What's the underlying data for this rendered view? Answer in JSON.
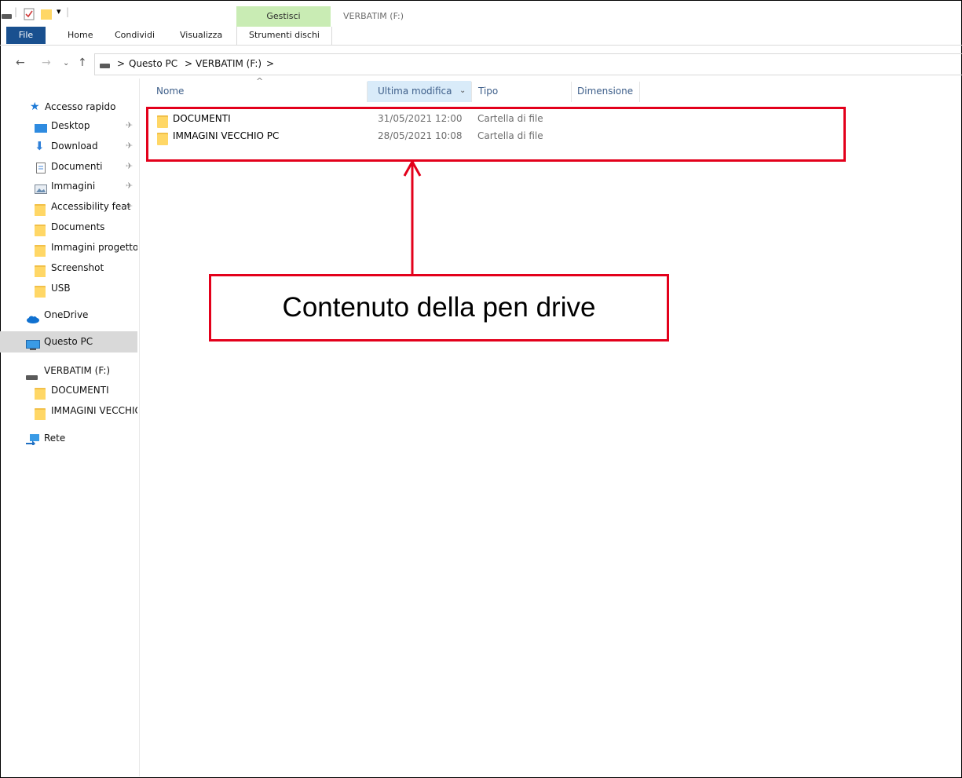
{
  "window": {
    "title": "VERBATIM (F:)",
    "context_tab_group": "Gestisci",
    "accent": "#19508f",
    "context_accent": "#c9ecb4"
  },
  "ribbon": {
    "tabs": [
      {
        "label": "File"
      },
      {
        "label": "Home"
      },
      {
        "label": "Condividi"
      },
      {
        "label": "Visualizza"
      },
      {
        "label": "Strumenti dischi"
      }
    ]
  },
  "address": {
    "crumbs": [
      "Questo PC",
      "VERBATIM (F:)"
    ],
    "separator": ">"
  },
  "sidebar": {
    "quick_access": "Accesso rapido",
    "items": [
      {
        "label": "Desktop",
        "icon": "desktop-icon",
        "pinned": true
      },
      {
        "label": "Download",
        "icon": "download-icon",
        "pinned": true
      },
      {
        "label": "Documenti",
        "icon": "documents-icon",
        "pinned": true
      },
      {
        "label": "Immagini",
        "icon": "pictures-icon",
        "pinned": true
      },
      {
        "label": "Accessibility feat",
        "icon": "folder-icon",
        "pinned": true
      },
      {
        "label": "Documents",
        "icon": "folder-icon",
        "pinned": false
      },
      {
        "label": "Immagini progetto",
        "icon": "folder-icon",
        "pinned": false
      },
      {
        "label": "Screenshot",
        "icon": "folder-icon",
        "pinned": false
      },
      {
        "label": "USB",
        "icon": "folder-icon",
        "pinned": false
      }
    ],
    "onedrive": "OneDrive",
    "this_pc": "Questo PC",
    "drive": "VERBATIM (F:)",
    "drive_children": [
      "DOCUMENTI",
      "IMMAGINI VECCHIO"
    ],
    "network": "Rete"
  },
  "list": {
    "columns": [
      "Nome",
      "Ultima modifica",
      "Tipo",
      "Dimensione"
    ],
    "sorted_column": "Ultima modifica",
    "rows": [
      {
        "name": "DOCUMENTI",
        "modified": "31/05/2021 12:00",
        "type": "Cartella di file",
        "size": ""
      },
      {
        "name": "IMMAGINI VECCHIO PC",
        "modified": "28/05/2021 10:08",
        "type": "Cartella di file",
        "size": ""
      }
    ]
  },
  "annotation": {
    "callout_text": "Contenuto della pen drive",
    "color": "#e3001b"
  }
}
